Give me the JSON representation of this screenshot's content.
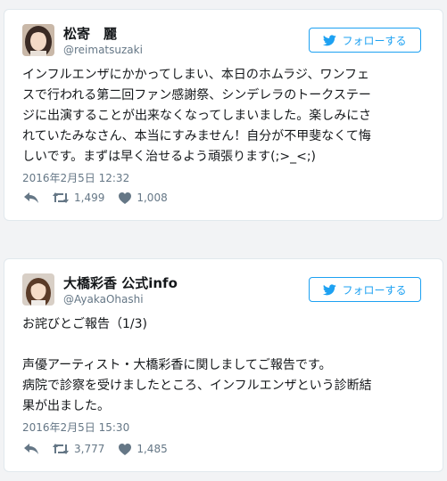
{
  "tweets": [
    {
      "name": "松寄　麗",
      "handle": "@reimatsuzaki",
      "follow_label": "フォローする",
      "text_lines": [
        "インフルエンザにかかってしまい、本日のホムラジ、ワンフェ",
        "スで行われる第二回ファン感謝祭、シンデレラのトークステー",
        "ジに出演することが出来なくなってしまいました。楽しみにさ",
        "れていたみなさん、本当にすみません！自分が不甲斐なくて悔",
        "しいです。まずは早く治せるよう頑張ります(;>_<;)"
      ],
      "timestamp": "2016年2月5日 12:32",
      "retweets": "1,499",
      "likes": "1,008",
      "avatar_icon": "woman-portrait"
    },
    {
      "name": "大橋彩香 公式info",
      "handle": "@AyakaOhashi",
      "follow_label": "フォローする",
      "text_lines": [
        "お詫びとご報告（1/3)",
        "",
        "声優アーティスト・大橋彩香に関しましてご報告です。",
        "病院で診察を受けましたところ、インフルエンザという診断結",
        "果が出ました。"
      ],
      "timestamp": "2016年2月5日 15:30",
      "retweets": "3,777",
      "likes": "1,485",
      "avatar_icon": "woman-portrait"
    }
  ],
  "colors": {
    "accent": "#1da1f2",
    "text": "#14171a",
    "secondary": "#657786",
    "border": "#e1e8ed"
  },
  "icons": {
    "follow": "twitter-bird-icon",
    "reply": "reply-icon",
    "retweet": "retweet-icon",
    "like": "heart-icon"
  }
}
